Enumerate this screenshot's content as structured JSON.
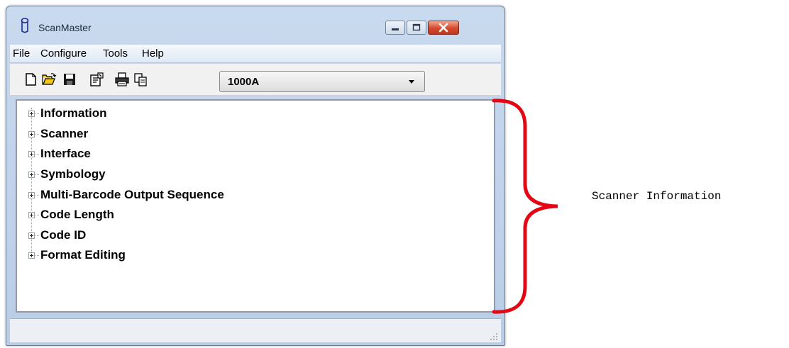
{
  "window": {
    "title": "ScanMaster"
  },
  "menu": {
    "items": [
      "File",
      "Configure",
      "Tools",
      "Help"
    ]
  },
  "toolbar": {
    "icons": [
      "new-file-icon",
      "open-folder-icon",
      "save-icon",
      "properties-icon",
      "print-icon",
      "copy-icon"
    ],
    "model_select": {
      "value": "1000A"
    }
  },
  "tree": {
    "items": [
      {
        "label": "Information"
      },
      {
        "label": "Scanner"
      },
      {
        "label": "Interface"
      },
      {
        "label": "Symbology"
      },
      {
        "label": "Multi-Barcode Output Sequence"
      },
      {
        "label": "Code Length"
      },
      {
        "label": "Code ID"
      },
      {
        "label": "Format Editing"
      }
    ]
  },
  "annotation": {
    "label": "Scanner Information",
    "brace_color": "#e30613"
  }
}
